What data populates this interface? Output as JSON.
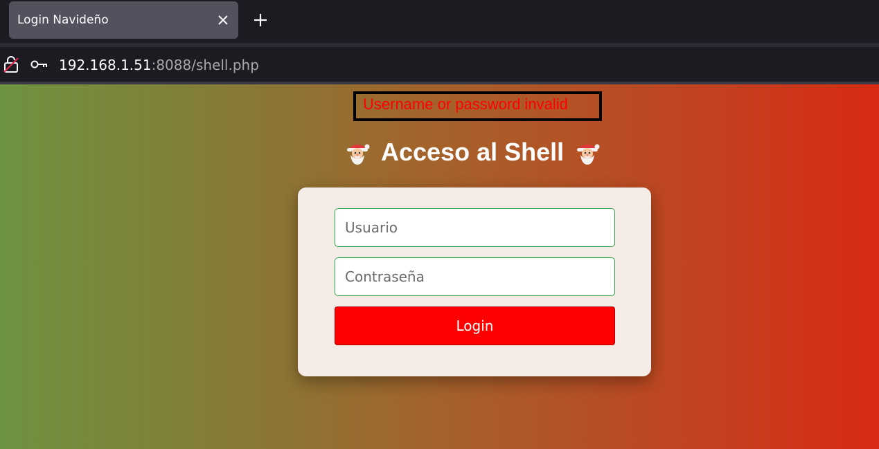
{
  "browser": {
    "tab_title": "Login Navideño",
    "url_host": "192.168.1.51",
    "url_rest": ":8088/shell.php",
    "icons": {
      "lock": "insecure-lock-icon",
      "key": "key-icon",
      "close": "close-icon",
      "new_tab": "plus-icon"
    }
  },
  "page": {
    "error_message": "Username or password invalid",
    "heading": "Acceso al Shell",
    "heading_emoji": "santa-claus-emoji",
    "username_placeholder": "Usuario",
    "password_placeholder": "Contraseña",
    "login_label": "Login",
    "colors": {
      "gradient_left": "#6e9340",
      "gradient_right": "#d82a14",
      "error_text": "#ff0000",
      "card_bg": "#f5ece8",
      "input_border": "#2ea043",
      "button_bg": "#ff0000"
    }
  }
}
